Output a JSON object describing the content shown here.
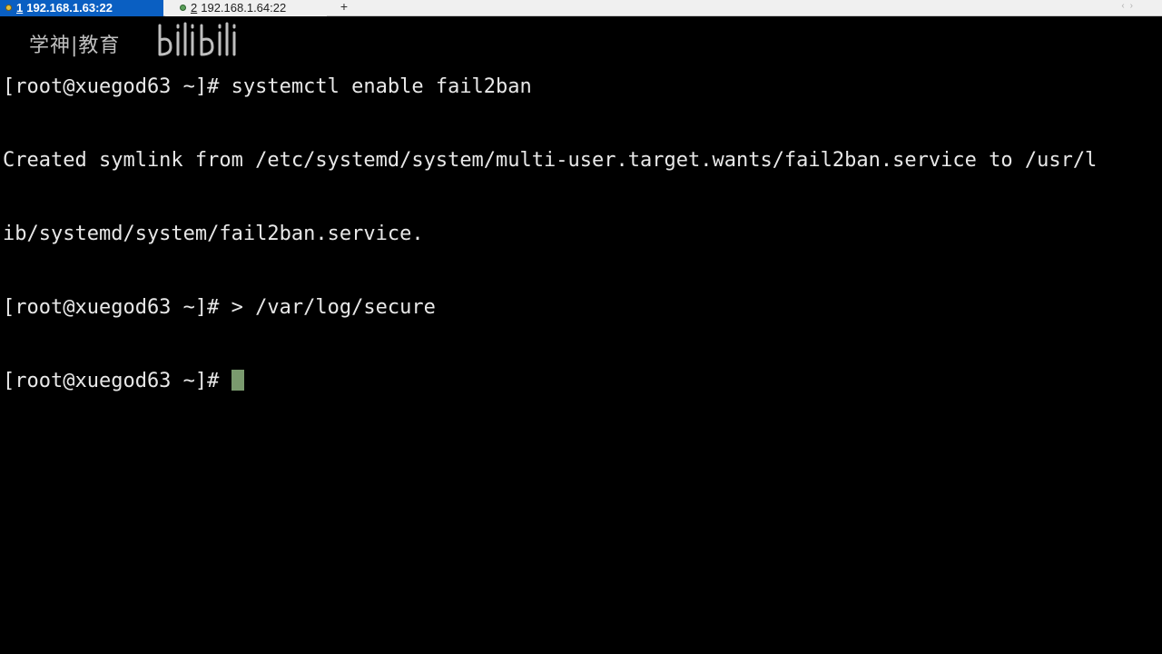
{
  "tabs": [
    {
      "number": "1",
      "label": "192.168.1.63:22",
      "active": true,
      "status_color": "#e0c040"
    },
    {
      "number": "2",
      "label": "192.168.1.64:22",
      "active": false,
      "status_color": "#5aa05a"
    }
  ],
  "add_tab_label": "+",
  "terminal": {
    "lines": [
      "[root@xuegod63 ~]# systemctl enable fail2ban",
      "Created symlink from /etc/systemd/system/multi-user.target.wants/fail2ban.service to /usr/l",
      "ib/systemd/system/fail2ban.service.",
      "[root@xuegod63 ~]# > /var/log/secure"
    ],
    "prompt": "[root@xuegod63 ~]# ",
    "cursor_color": "#7a9a6e"
  },
  "watermark": {
    "text": "学神|教育",
    "logo": "bilibili-logo"
  },
  "colors": {
    "background": "#000000",
    "foreground": "#e8e8e8",
    "active_tab": "#0a5fc2"
  }
}
